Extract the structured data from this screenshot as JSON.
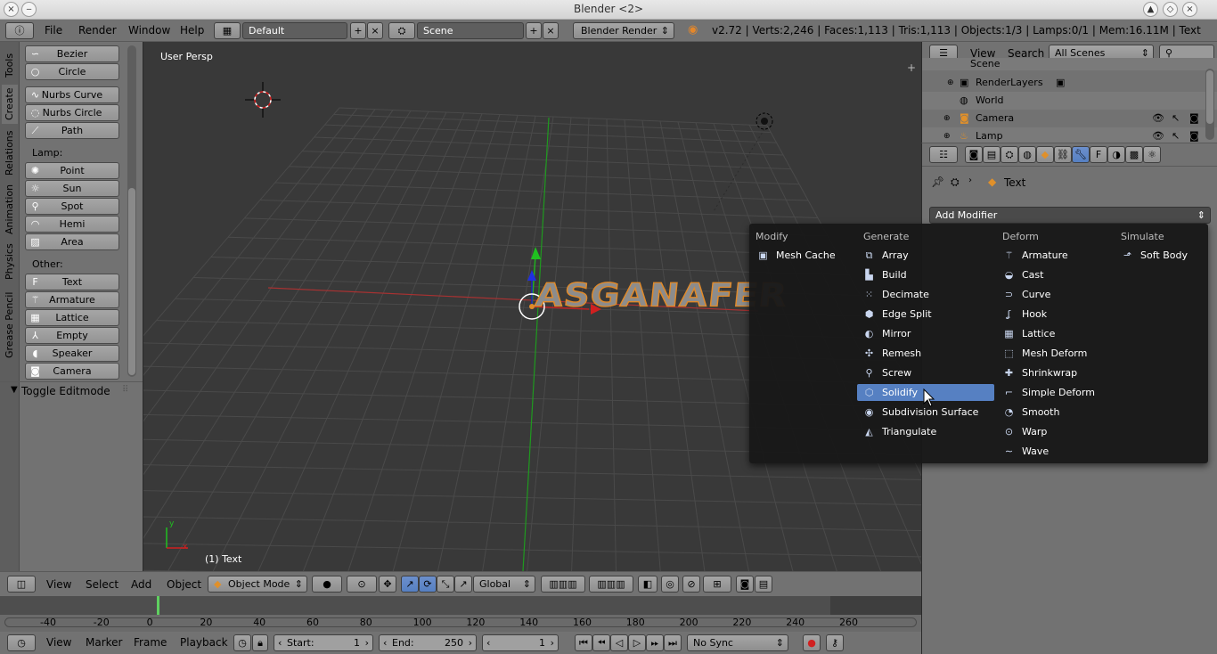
{
  "window": {
    "title": "Blender <2>",
    "close_glyph": "×",
    "min_glyph": "‒",
    "max_glyph": "◇"
  },
  "info": {
    "menus": [
      "File",
      "Render",
      "Window",
      "Help"
    ],
    "screen": "Default",
    "scene": "Scene",
    "engine": "Blender Render",
    "stats": "v2.72 | Verts:2,246 | Faces:1,113 | Tris:1,113 | Objects:1/3 | Lamps:0/1 | Mem:16.11M | Text"
  },
  "toolshelf": {
    "tabs": [
      "Tools",
      "Create",
      "Relations",
      "Animation",
      "Physics",
      "Grease Pencil"
    ],
    "curve_items": [
      "Bezier",
      "Circle",
      "Nurbs Curve",
      "Nurbs Circle",
      "Path"
    ],
    "lamp_label": "Lamp:",
    "lamp_items": [
      "Point",
      "Sun",
      "Spot",
      "Hemi",
      "Area"
    ],
    "other_label": "Other:",
    "other_items": [
      "Text",
      "Armature",
      "Lattice",
      "Empty",
      "Speaker",
      "Camera"
    ],
    "toggle_editmode": "Toggle Editmode"
  },
  "viewport": {
    "view_label": "User Persp",
    "object_label": "(1) Text",
    "text_object": "ASGANAFER",
    "axis_y": "y",
    "axis_x": "x"
  },
  "view3d_header": {
    "menus": [
      "View",
      "Select",
      "Add",
      "Object"
    ],
    "mode": "Object Mode",
    "orientation": "Global"
  },
  "timeline": {
    "ticks": [
      "-40",
      "-20",
      "0",
      "20",
      "40",
      "60",
      "80",
      "100",
      "120",
      "140",
      "160",
      "180",
      "200",
      "220",
      "240",
      "260"
    ],
    "menus": [
      "View",
      "Marker",
      "Frame",
      "Playback"
    ],
    "start_label": "Start:",
    "start_value": "1",
    "end_label": "End:",
    "end_value": "250",
    "current_frame": "1",
    "sync": "No Sync"
  },
  "outliner": {
    "menus": [
      "View",
      "Search"
    ],
    "filter": "All Scenes",
    "items": [
      "Scene",
      "RenderLayers",
      "World",
      "Camera",
      "Lamp"
    ]
  },
  "properties": {
    "breadcrumb": "Text",
    "add_modifier": "Add Modifier"
  },
  "modifier_menu": {
    "columns": [
      {
        "header": "Modify",
        "items": [
          {
            "label": "Mesh Cache",
            "icon": "mesh-cache-icon"
          }
        ]
      },
      {
        "header": "Generate",
        "items": [
          {
            "label": "Array",
            "icon": "array-icon"
          },
          {
            "label": "Build",
            "icon": "build-icon"
          },
          {
            "label": "Decimate",
            "icon": "decimate-icon"
          },
          {
            "label": "Edge Split",
            "icon": "edge-split-icon"
          },
          {
            "label": "Mirror",
            "icon": "mirror-icon"
          },
          {
            "label": "Remesh",
            "icon": "remesh-icon"
          },
          {
            "label": "Screw",
            "icon": "screw-icon"
          },
          {
            "label": "Solidify",
            "icon": "solidify-icon"
          },
          {
            "label": "Subdivision Surface",
            "icon": "subsurf-icon"
          },
          {
            "label": "Triangulate",
            "icon": "triangulate-icon"
          }
        ]
      },
      {
        "header": "Deform",
        "items": [
          {
            "label": "Armature",
            "icon": "armature-icon"
          },
          {
            "label": "Cast",
            "icon": "cast-icon"
          },
          {
            "label": "Curve",
            "icon": "curve-icon"
          },
          {
            "label": "Hook",
            "icon": "hook-icon"
          },
          {
            "label": "Lattice",
            "icon": "lattice-icon"
          },
          {
            "label": "Mesh Deform",
            "icon": "mesh-deform-icon"
          },
          {
            "label": "Shrinkwrap",
            "icon": "shrinkwrap-icon"
          },
          {
            "label": "Simple Deform",
            "icon": "simple-deform-icon"
          },
          {
            "label": "Smooth",
            "icon": "smooth-icon"
          },
          {
            "label": "Warp",
            "icon": "warp-icon"
          },
          {
            "label": "Wave",
            "icon": "wave-icon"
          }
        ]
      },
      {
        "header": "Simulate",
        "items": [
          {
            "label": "Soft Body",
            "icon": "soft-body-icon"
          }
        ]
      }
    ],
    "highlighted": "Solidify"
  },
  "colors": {
    "highlight": "#5680c2",
    "panel": "#727272",
    "viewport_bg": "#393939",
    "text_object_fill": "#8c8c8c",
    "selection_outline": "#e08a2a"
  }
}
